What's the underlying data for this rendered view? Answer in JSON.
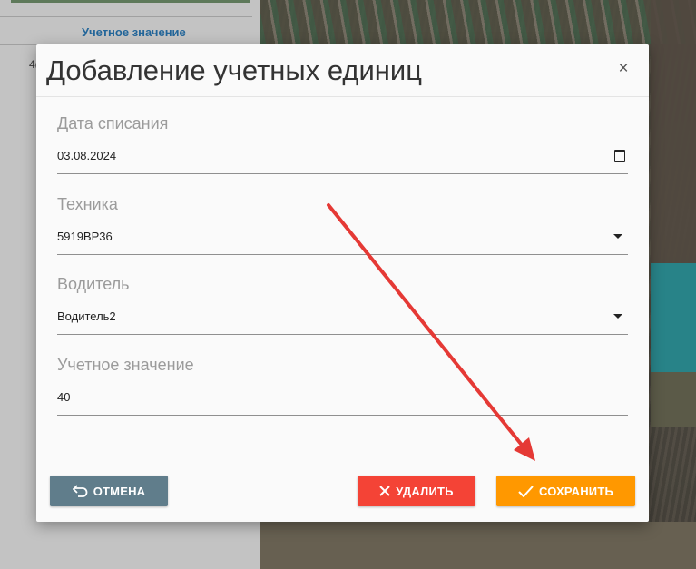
{
  "background": {
    "left_panel": {
      "column_header": "Учетное значение",
      "cell_value": "4("
    }
  },
  "dialog": {
    "title": "Добавление учетных единиц",
    "close_label": "×",
    "fields": {
      "writeoff_date": {
        "label": "Дата списания",
        "value": "03.08.2024"
      },
      "equipment": {
        "label": "Техника",
        "value": "5919ВР36"
      },
      "driver": {
        "label": "Водитель",
        "value": "Водитель2"
      },
      "account_value": {
        "label": "Учетное значение",
        "value": "40"
      }
    },
    "buttons": {
      "cancel": "ОТМЕНА",
      "delete": "УДАЛИТЬ",
      "save": "СОХРАНИТЬ"
    }
  },
  "colors": {
    "cancel": "#607d8b",
    "delete": "#f44336",
    "save": "#ff9800",
    "annotation_arrow": "#e53935"
  }
}
